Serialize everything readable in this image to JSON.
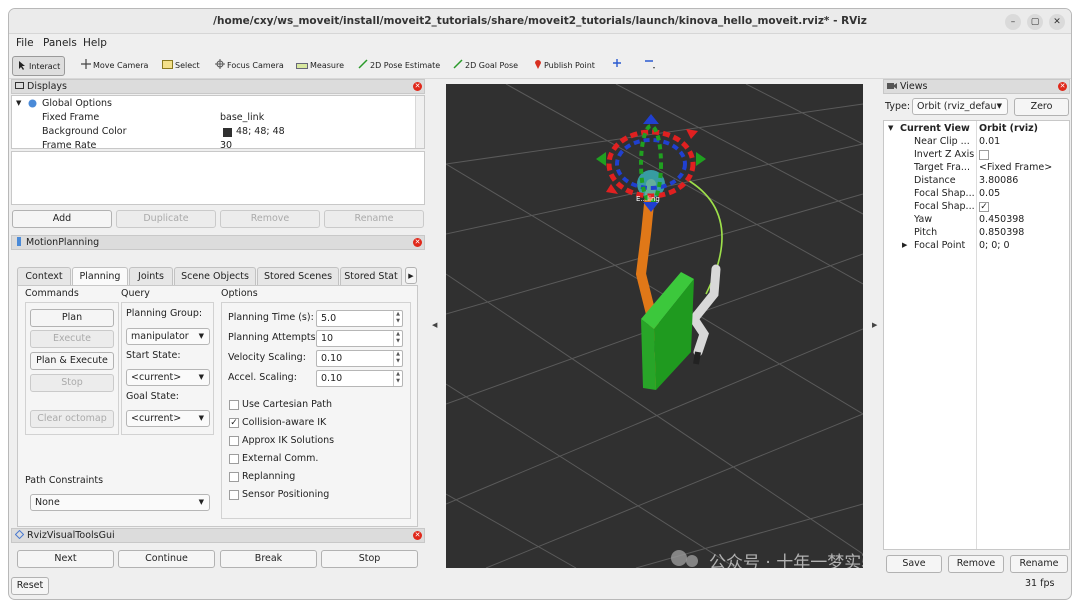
{
  "window": {
    "title": "/home/cxy/ws_moveit/install/moveit2_tutorials/share/moveit2_tutorials/launch/kinova_hello_moveit.rviz* - RViz",
    "minimize": "–",
    "maximize": "▢",
    "close": "✕"
  },
  "menu": {
    "file": "File",
    "panels": "Panels",
    "help": "Help"
  },
  "toolbar": {
    "interact": "Interact",
    "move_camera": "Move Camera",
    "select": "Select",
    "focus_camera": "Focus Camera",
    "measure": "Measure",
    "pose_estimate": "2D Pose Estimate",
    "goal_pose": "2D Goal Pose",
    "publish_point": "Publish Point"
  },
  "displays": {
    "header": "Displays",
    "tree": {
      "global_options": "Global Options",
      "fixed_frame": "Fixed Frame",
      "fixed_frame_val": "base_link",
      "bg_color": "Background Color",
      "bg_color_val": "48; 48; 48",
      "frame_rate": "Frame Rate",
      "frame_rate_val": "30"
    },
    "buttons": {
      "add": "Add",
      "duplicate": "Duplicate",
      "remove": "Remove",
      "rename": "Rename"
    }
  },
  "motion": {
    "header": "MotionPlanning",
    "tabs": [
      "Context",
      "Planning",
      "Joints",
      "Scene Objects",
      "Stored Scenes",
      "Stored Stat"
    ],
    "commands": {
      "title": "Commands",
      "plan": "Plan",
      "execute": "Execute",
      "plan_execute": "Plan & Execute",
      "stop": "Stop",
      "clear_octomap": "Clear octomap"
    },
    "query": {
      "title": "Query",
      "planning_group_label": "Planning Group:",
      "planning_group": "manipulator",
      "start_state_label": "Start State:",
      "start_state": "<current>",
      "goal_state_label": "Goal State:",
      "goal_state": "<current>"
    },
    "options": {
      "title": "Options",
      "planning_time_label": "Planning Time (s):",
      "planning_time": "5.0",
      "planning_attempts_label": "Planning Attempts:",
      "planning_attempts": "10",
      "velocity_label": "Velocity Scaling:",
      "velocity": "0.10",
      "accel_label": "Accel. Scaling:",
      "accel": "0.10",
      "use_cartesian": "Use Cartesian Path",
      "collision_ik": "Collision-aware IK",
      "approx_ik": "Approx IK Solutions",
      "external_comm": "External Comm.",
      "replanning": "Replanning",
      "sensor_positioning": "Sensor Positioning"
    },
    "path_constraints": {
      "title": "Path Constraints",
      "value": "None"
    }
  },
  "rviz_tools": {
    "header": "RvizVisualToolsGui",
    "next": "Next",
    "continue": "Continue",
    "break": "Break",
    "stop": "Stop"
  },
  "bottom": {
    "reset": "Reset",
    "fps": "31 fps"
  },
  "viewport": {
    "label": "E...ling",
    "watermark": "公众号 · 十年一梦实验室"
  },
  "views": {
    "header": "Views",
    "type_label": "Type:",
    "type_value": "Orbit (rviz_defau",
    "zero": "Zero",
    "current_view": "Current View",
    "current_view_val": "Orbit (rviz)",
    "rows": [
      {
        "k": "Near Clip ...",
        "v": "0.01"
      },
      {
        "k": "Invert Z Axis",
        "v": ""
      },
      {
        "k": "Target Fra...",
        "v": "<Fixed Frame>"
      },
      {
        "k": "Distance",
        "v": "3.80086"
      },
      {
        "k": "Focal Shap...",
        "v": "0.05"
      },
      {
        "k": "Focal Shap...",
        "v": "✓"
      },
      {
        "k": "Yaw",
        "v": "0.450398"
      },
      {
        "k": "Pitch",
        "v": "0.850398"
      },
      {
        "k": "Focal Point",
        "v": "0; 0; 0"
      }
    ],
    "save": "Save",
    "remove": "Remove",
    "rename": "Rename"
  },
  "colors": {
    "bg": "#303030",
    "grid": "#5a5a5a",
    "box": "#28a528",
    "orange": "#e07818"
  }
}
